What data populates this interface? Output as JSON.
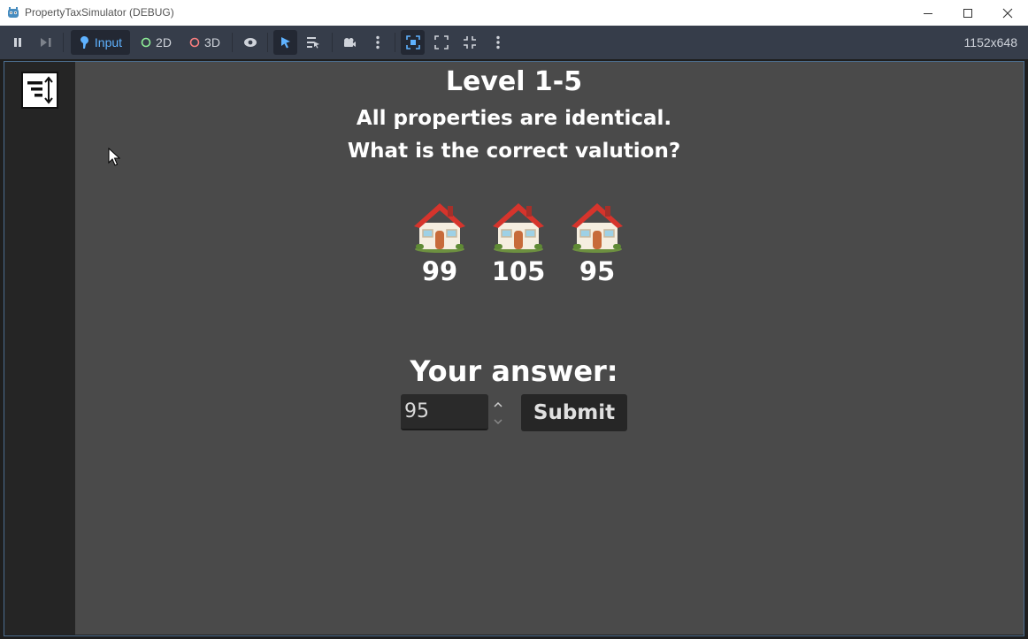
{
  "window": {
    "title": "PropertyTaxSimulator (DEBUG)"
  },
  "toolbar": {
    "input_label": "Input",
    "mode_2d_label": "2D",
    "mode_3d_label": "3D",
    "resolution": "1152x648"
  },
  "game": {
    "level_title": "Level 1-5",
    "instruction_line1": "All properties are identical.",
    "instruction_line2": "What is the correct valution?",
    "properties": [
      {
        "value": "99"
      },
      {
        "value": "105"
      },
      {
        "value": "95"
      }
    ],
    "answer_label": "Your answer:",
    "answer_value": "95",
    "submit_label": "Submit"
  },
  "colors": {
    "toolbar_bg": "#363d4a",
    "accent": "#5fb2ff",
    "game_bg": "#4a4a4a",
    "side_panel": "#252525"
  }
}
